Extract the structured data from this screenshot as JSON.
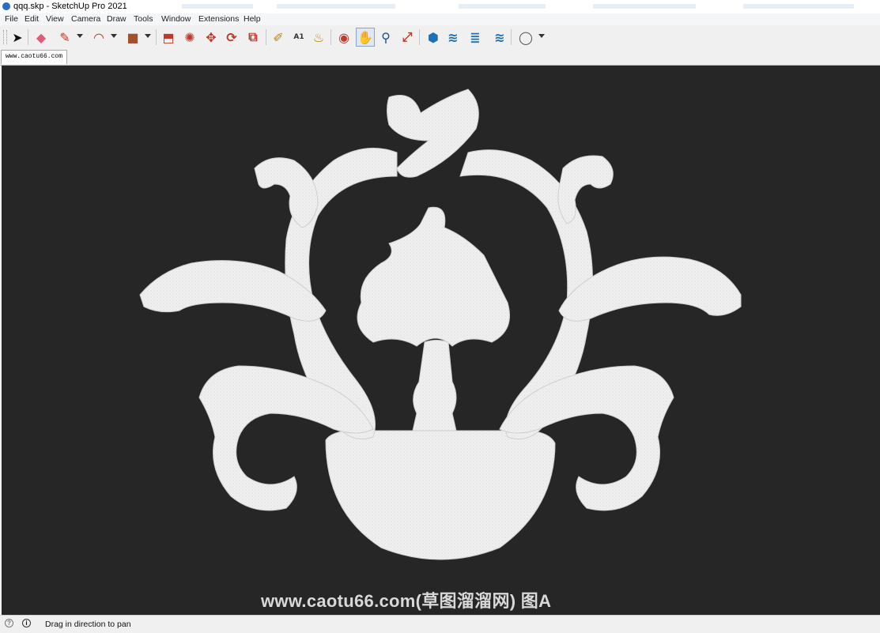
{
  "window": {
    "title": "qqq.skp - SketchUp Pro 2021"
  },
  "menu": [
    "File",
    "Edit",
    "View",
    "Camera",
    "Draw",
    "Tools",
    "Window",
    "Extensions",
    "Help"
  ],
  "toolbar": {
    "tools": [
      {
        "name": "select-tool-icon",
        "glyph": "➤",
        "color": "#111111"
      },
      {
        "name": "eraser-tool-icon",
        "glyph": "◆",
        "color": "#e05a7a"
      },
      {
        "name": "pencil-tool-icon",
        "glyph": "✎",
        "color": "#c0392b"
      },
      {
        "name": "arc-tool-icon",
        "glyph": "◠",
        "color": "#c0392b"
      },
      {
        "name": "rectangle-tool-icon",
        "glyph": "■",
        "color": "#a0522d"
      },
      {
        "name": "push-pull-tool-icon",
        "glyph": "⬒",
        "color": "#c0392b"
      },
      {
        "name": "follow-me-tool-icon",
        "glyph": "✺",
        "color": "#c0392b"
      },
      {
        "name": "move-tool-icon",
        "glyph": "✥",
        "color": "#c0392b"
      },
      {
        "name": "rotate-tool-icon",
        "glyph": "⟳",
        "color": "#c0392b"
      },
      {
        "name": "scale-tool-icon",
        "glyph": "⧉",
        "color": "#c0392b"
      },
      {
        "name": "tape-measure-tool-icon",
        "glyph": "✐",
        "color": "#b8860b"
      },
      {
        "name": "text-tool-icon",
        "glyph": "A1",
        "color": "#333333"
      },
      {
        "name": "paint-bucket-tool-icon",
        "glyph": "♨",
        "color": "#b8860b"
      },
      {
        "name": "orbit-tool-icon",
        "glyph": "◉",
        "color": "#c0392b"
      },
      {
        "name": "pan-tool-icon",
        "glyph": "✋",
        "color": "#b8860b"
      },
      {
        "name": "zoom-tool-icon",
        "glyph": "⚲",
        "color": "#1f4e8c"
      },
      {
        "name": "zoom-extents-tool-icon",
        "glyph": "⤢",
        "color": "#c0392b"
      },
      {
        "name": "warehouse-icon",
        "glyph": "⬢",
        "color": "#1f6fb2"
      },
      {
        "name": "extension-warehouse-icon",
        "glyph": "≋",
        "color": "#1f6fb2"
      },
      {
        "name": "layout-icon",
        "glyph": "≣",
        "color": "#1f6fb2"
      },
      {
        "name": "extension-manager-icon",
        "glyph": "≋",
        "color": "#1f6fb2"
      },
      {
        "name": "account-icon",
        "glyph": "◯",
        "color": "#555555"
      }
    ]
  },
  "scene_tab": {
    "label": "www.caotu66.com"
  },
  "viewport": {
    "background": "#262626",
    "model_color": "#efefef",
    "watermark": "www.caotu66.com(草图溜溜网) 图A"
  },
  "status": {
    "text": "Drag in direction to pan"
  }
}
